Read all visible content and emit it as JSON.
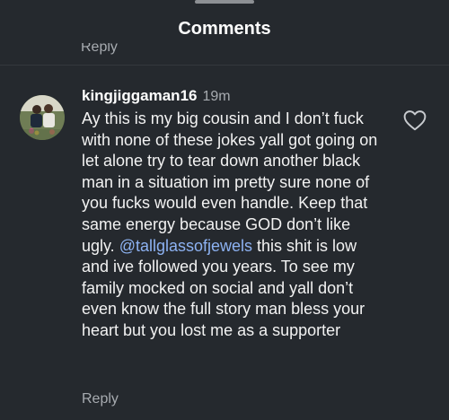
{
  "header": {
    "title": "Comments"
  },
  "previous_reply": {
    "label": "Reply"
  },
  "comment": {
    "username": "kingjiggaman16",
    "time": "19m",
    "text_before": "Ay this is my big cousin and I don’t fuck with none of these jokes yall got going on let alone try to tear down another black man in a situation im pretty sure none of you fucks would even handle. Keep that same energy because GOD don’t like ugly. ",
    "mention": "@tallglassofjewels",
    "text_after": " this shit is low and ive followed you years. To see my family mocked on social and yall don’t even know the full story man bless your heart but you lost me as a supporter",
    "reply_label": "Reply",
    "like_icon": "heart-outline-icon"
  },
  "colors": {
    "background": "#25292e",
    "text": "#f2f2f2",
    "muted": "#a7abb0",
    "mention": "#8db2f2"
  }
}
